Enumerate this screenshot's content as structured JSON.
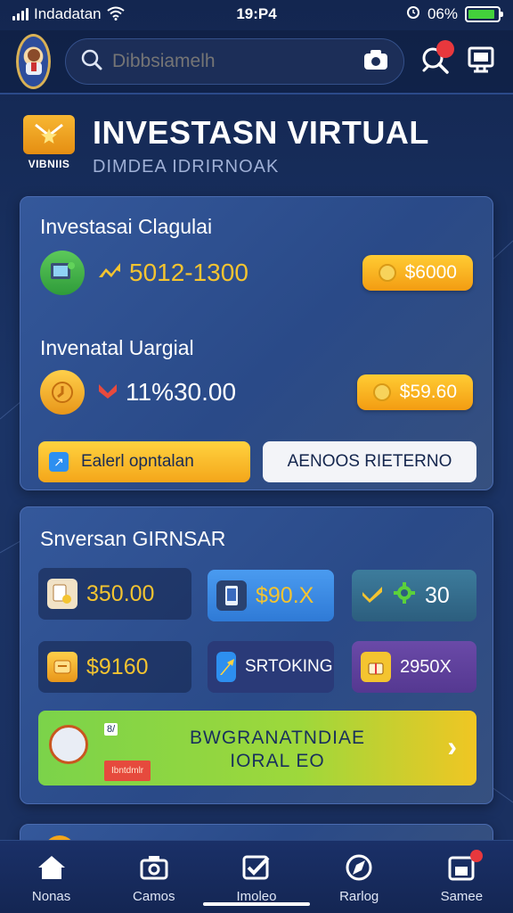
{
  "status_bar": {
    "carrier": "Indadatan",
    "time": "19:P4",
    "battery": "06%"
  },
  "header": {
    "search_placeholder": "Dibbsiamelh"
  },
  "title": {
    "main": "INVESTASN VIRTUAL",
    "sub": "DIMDEA IDRIRNOAK",
    "logo_label": "VIBNIIS"
  },
  "card1": {
    "rows": [
      {
        "label": "Investasai Clagulai",
        "value": "5012-1300",
        "value_prefix": "",
        "button": "$6000"
      },
      {
        "label": "Invenatal Uargial",
        "value": "11%30.00",
        "button": "$59.60"
      }
    ],
    "btn_primary": "Ealerl opntalan",
    "btn_secondary": "AENOOS RIETERNO"
  },
  "card2": {
    "title": "Snversan GIRNSAR",
    "tiles": [
      {
        "text": "350.00",
        "style": "dark"
      },
      {
        "text": "$90.X",
        "style": "blue"
      },
      {
        "text": "30",
        "style": "teal"
      },
      {
        "text": "$9160",
        "style": "dark"
      },
      {
        "text": "SRTOKING",
        "style": "navy"
      },
      {
        "text": "2950X",
        "style": "purple"
      }
    ],
    "cta": {
      "line1": "BWGRANATNDIAE",
      "line2": "IORAL EO",
      "tag": "Ibntdmlr",
      "badge": "8/"
    }
  },
  "nav": [
    {
      "label": "Nonas",
      "icon": "home-icon"
    },
    {
      "label": "Camos",
      "icon": "camera-icon"
    },
    {
      "label": "Imoleo",
      "icon": "checkbox-icon"
    },
    {
      "label": "Rarlog",
      "icon": "compass-icon"
    },
    {
      "label": "Samee",
      "icon": "profile-icon"
    }
  ],
  "colors": {
    "accent": "#f4a61a",
    "background": "#1b3466",
    "cta_green": "#7bd34a"
  }
}
